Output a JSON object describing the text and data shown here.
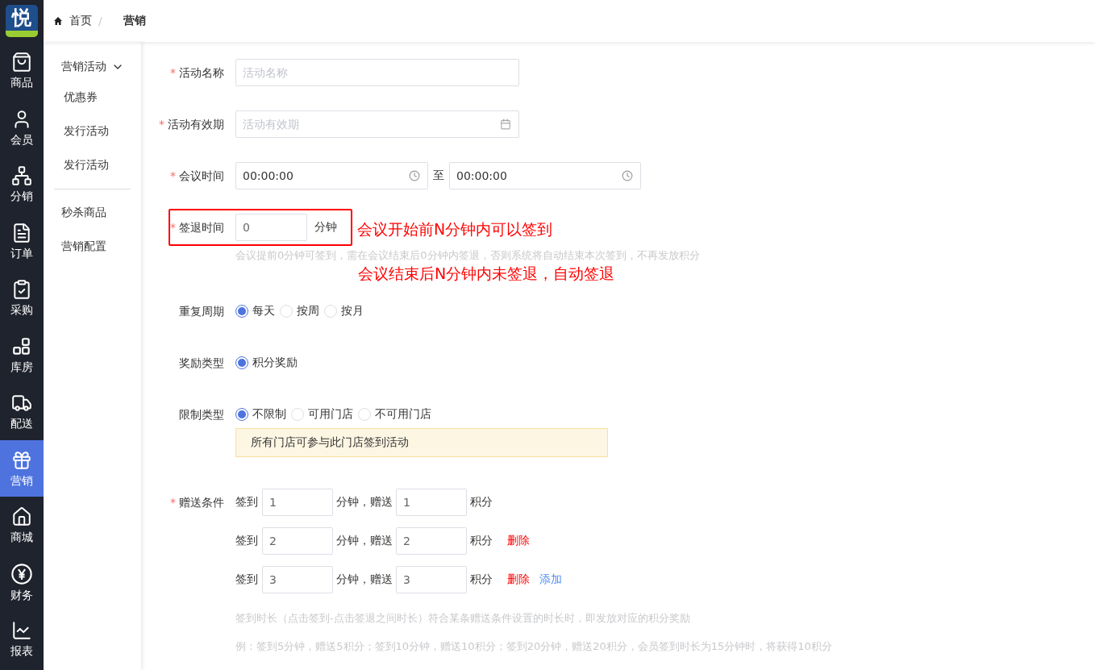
{
  "logo": {
    "text": "悦"
  },
  "nav": [
    {
      "label": "商品",
      "selected": false
    },
    {
      "label": "会员",
      "selected": false
    },
    {
      "label": "分销",
      "selected": false
    },
    {
      "label": "订单",
      "selected": false
    },
    {
      "label": "采购",
      "selected": false
    },
    {
      "label": "库房",
      "selected": false
    },
    {
      "label": "配送",
      "selected": false
    },
    {
      "label": "营销",
      "selected": true
    },
    {
      "label": "商城",
      "selected": false
    },
    {
      "label": "财务",
      "selected": false
    },
    {
      "label": "报表",
      "selected": false
    }
  ],
  "breadcrumb": {
    "separator": "/",
    "items": [
      {
        "label": "首页",
        "current": false
      },
      {
        "label": "营销",
        "current": true
      }
    ]
  },
  "submenu": {
    "group": {
      "label": "营销活动",
      "expanded": true,
      "children": [
        {
          "label": "优惠券"
        },
        {
          "label": "发行活动"
        },
        {
          "label": "发行活动"
        }
      ]
    },
    "items": [
      {
        "label": "秒杀商品"
      },
      {
        "label": "营销配置"
      }
    ]
  },
  "form": [
    {
      "kind": "text",
      "label": "活动名称",
      "required_mark": "*",
      "placeholder": "活动名称"
    },
    {
      "kind": "date",
      "label": "活动有效期",
      "required_mark": "*",
      "placeholder": "活动有效期"
    },
    {
      "kind": "time_range",
      "label": "会议时间",
      "required_mark": "*",
      "start": "00:00:00",
      "separator": "至",
      "end": "00:00:00"
    },
    {
      "kind": "number_unit",
      "label": "签退时间",
      "required_mark": "*",
      "value": "0",
      "unit": "分钟",
      "highlighted": true,
      "annotation": "会议开始前N分钟内可以签到",
      "hint": "会议提前0分钟可签到，需在会议结束后0分钟内签退，否则系统将自动结束本次签到，不再发放积分",
      "annotation_below": "会议结束后N分钟内未签退，自动签退"
    },
    {
      "kind": "radio",
      "label": "重复周期",
      "options": [
        {
          "label": "每天",
          "selected": true
        },
        {
          "label": "按周",
          "selected": false
        },
        {
          "label": "按月",
          "selected": false
        }
      ]
    },
    {
      "kind": "radio",
      "label": "奖励类型",
      "options": [
        {
          "label": "积分奖励",
          "selected": true
        }
      ]
    },
    {
      "kind": "radio",
      "label": "限制类型",
      "options": [
        {
          "label": "不限制",
          "selected": true
        },
        {
          "label": "可用门店",
          "selected": false
        },
        {
          "label": "不可用门店",
          "selected": false
        }
      ],
      "notice": "所有门店可参与此门店签到活动"
    },
    {
      "kind": "rules",
      "label": "赠送条件",
      "required_mark": "*",
      "rules": [
        {
          "prefix": "签到",
          "minutes": "1",
          "middle": "分钟，赠送",
          "points": "1",
          "suffix": "积分"
        },
        {
          "prefix": "签到",
          "minutes": "2",
          "middle": "分钟，赠送",
          "points": "2",
          "suffix": "积分",
          "actions": [
            {
              "kind": "delete",
              "label": "删除"
            }
          ]
        },
        {
          "prefix": "签到",
          "minutes": "3",
          "middle": "分钟，赠送",
          "points": "3",
          "suffix": "积分",
          "actions": [
            {
              "kind": "delete",
              "label": "删除"
            },
            {
              "kind": "add",
              "label": "添加"
            }
          ]
        }
      ],
      "hints": [
        "签到时长（点击签到-点击签退之间时长）符合某条赠送条件设置的时长时，即发放对应的积分奖励",
        "例：签到5分钟，赠送5积分；签到10分钟，赠送10积分；签到20分钟，赠送20积分，会员签到时长为15分钟时，将获得10积分"
      ]
    }
  ]
}
